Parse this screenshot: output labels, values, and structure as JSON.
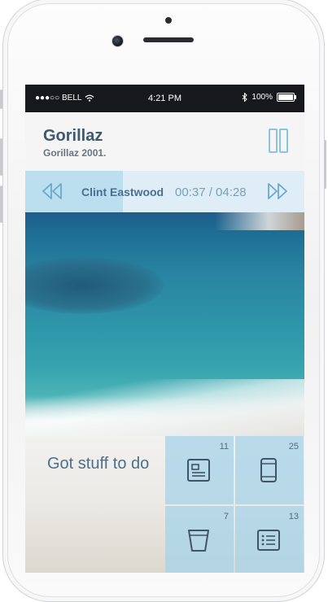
{
  "status_bar": {
    "carrier": "●●●○○ BELL",
    "time": "4:21 PM",
    "battery": "100%"
  },
  "album": {
    "artist": "Gorillaz",
    "title": "Gorillaz 2001."
  },
  "player": {
    "song": "Clint Eastwood",
    "time": "00:37 / 04:28",
    "progress": 0.35
  },
  "todo": {
    "title": "Got stuff to do",
    "tiles": [
      {
        "count": "11",
        "icon": "document-icon"
      },
      {
        "count": "25",
        "icon": "phone-icon"
      },
      {
        "count": "7",
        "icon": "cup-icon"
      },
      {
        "count": "13",
        "icon": "list-icon"
      }
    ]
  },
  "colors": {
    "accent": "#8dc3dd",
    "title": "#3d5870",
    "tile": "#a8d4e8"
  }
}
